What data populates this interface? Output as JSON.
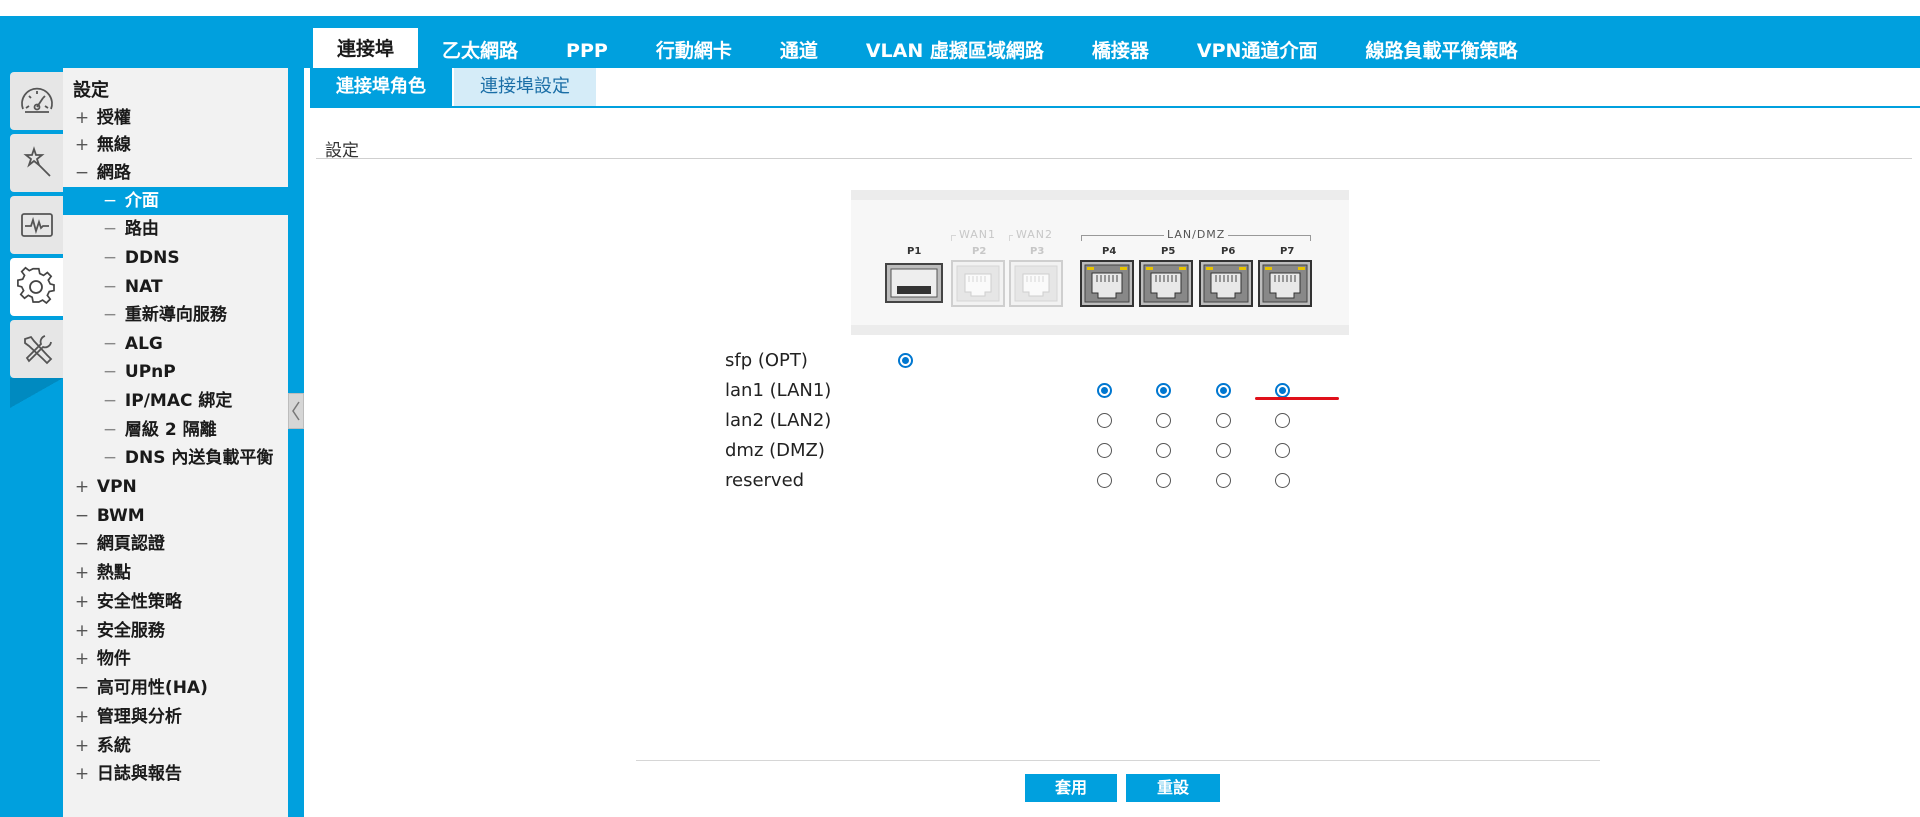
{
  "top_tabs": [
    "連接埠",
    "乙太網路",
    "PPP",
    "行動網卡",
    "通道",
    "VLAN 虛擬區域網路",
    "橋接器",
    "VPN通道介面",
    "線路負載平衡策略"
  ],
  "active_top_tab": 0,
  "rail": [
    "dashboard-gauge-icon",
    "quick-setup-wand-icon",
    "monitor-pulse-icon",
    "settings-gear-icon",
    "maintenance-tools-icon"
  ],
  "sidebar": {
    "title": "設定",
    "items": [
      {
        "mark": "+",
        "label": "授權"
      },
      {
        "mark": "+",
        "label": "無線"
      },
      {
        "mark": "−",
        "label": "網路"
      },
      {
        "mark": "−",
        "label": "介面"
      },
      {
        "mark": "−",
        "label": "路由"
      },
      {
        "mark": "−",
        "label": "DDNS"
      },
      {
        "mark": "−",
        "label": "NAT"
      },
      {
        "mark": "−",
        "label": "重新導向服務"
      },
      {
        "mark": "−",
        "label": "ALG"
      },
      {
        "mark": "−",
        "label": "UPnP"
      },
      {
        "mark": "−",
        "label": "IP/MAC 綁定"
      },
      {
        "mark": "−",
        "label": "層級 2 隔離"
      },
      {
        "mark": "−",
        "label": "DNS 內送負載平衡"
      },
      {
        "mark": "+",
        "label": "VPN"
      },
      {
        "mark": "−",
        "label": "BWM"
      },
      {
        "mark": "−",
        "label": "網頁認證"
      },
      {
        "mark": "+",
        "label": "熱點"
      },
      {
        "mark": "+",
        "label": "安全性策略"
      },
      {
        "mark": "+",
        "label": "安全服務"
      },
      {
        "mark": "+",
        "label": "物件"
      },
      {
        "mark": "−",
        "label": "高可用性(HA)"
      },
      {
        "mark": "+",
        "label": "管理與分析"
      },
      {
        "mark": "+",
        "label": "系統"
      },
      {
        "mark": "+",
        "label": "日誌與報告"
      }
    ]
  },
  "sub_tabs": [
    "連接埠角色",
    "連接埠設定"
  ],
  "section_title": "設定",
  "device": {
    "ports": [
      {
        "label": "P1",
        "kind": "sfp",
        "enabled": true
      },
      {
        "label": "P2",
        "kind": "rj45",
        "enabled": false
      },
      {
        "label": "P3",
        "kind": "rj45",
        "enabled": false
      },
      {
        "label": "P4",
        "kind": "rj45",
        "enabled": true
      },
      {
        "label": "P5",
        "kind": "rj45",
        "enabled": true
      },
      {
        "label": "P6",
        "kind": "rj45",
        "enabled": true
      },
      {
        "label": "P7",
        "kind": "rj45",
        "enabled": true
      }
    ],
    "groups": {
      "wan1": "WAN1",
      "wan2": "WAN2",
      "lan_dmz": "LAN/DMZ"
    }
  },
  "roles": [
    {
      "label": "sfp (OPT)",
      "selection": [
        "checked",
        null,
        null,
        null,
        null,
        null,
        null
      ]
    },
    {
      "label": "lan1 (LAN1)",
      "selection": [
        null,
        null,
        null,
        "checked",
        "checked",
        "checked",
        "checked"
      ]
    },
    {
      "label": "lan2 (LAN2)",
      "selection": [
        null,
        null,
        null,
        "empty",
        "empty",
        "empty",
        "empty"
      ]
    },
    {
      "label": "dmz (DMZ)",
      "selection": [
        null,
        null,
        null,
        "empty",
        "empty",
        "empty",
        "empty"
      ]
    },
    {
      "label": "reserved",
      "selection": [
        null,
        null,
        null,
        "empty",
        "empty",
        "empty",
        "empty"
      ]
    }
  ],
  "buttons": {
    "apply": "套用",
    "reset": "重設"
  },
  "colors": {
    "brand": "#00a0de",
    "radio": "#0077d0",
    "highlight": "#e0101a"
  }
}
